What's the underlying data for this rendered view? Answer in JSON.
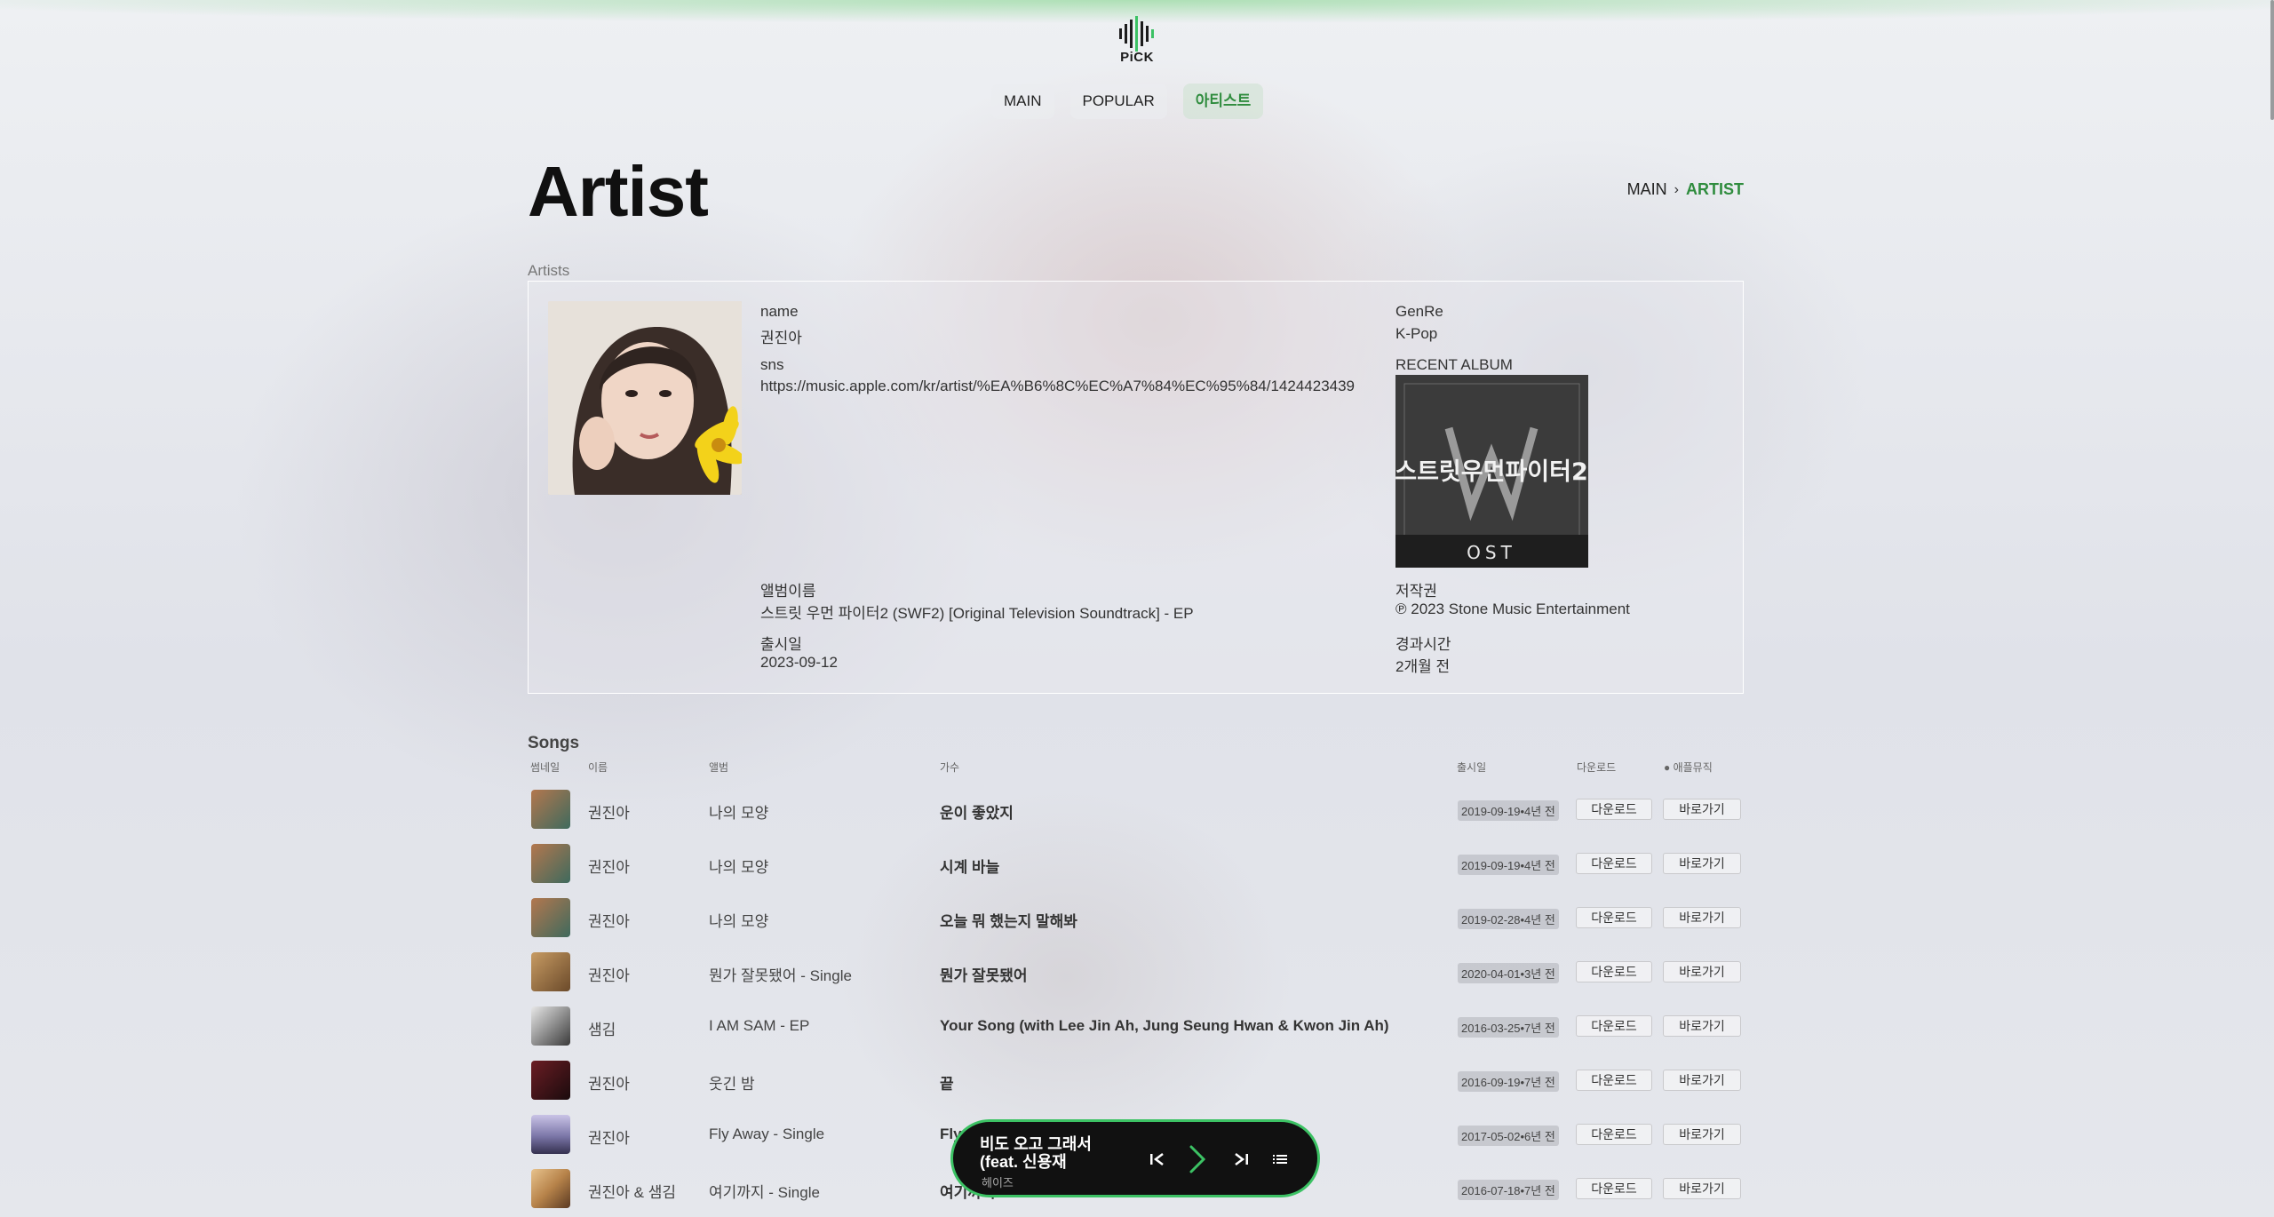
{
  "logo": {
    "text": "PiCK"
  },
  "nav": [
    {
      "label": "MAIN",
      "active": false
    },
    {
      "label": "POPULAR",
      "active": false
    },
    {
      "label": "아티스트",
      "active": true
    }
  ],
  "page": {
    "title": "Artist"
  },
  "breadcrumb": {
    "home": "MAIN",
    "current": "ARTIST"
  },
  "artist_section": {
    "label": "Artists",
    "name_label": "name",
    "name": "권진아",
    "genre_label": "GenRe",
    "genre": "K-Pop",
    "sns_label": "sns",
    "sns": "https://music.apple.com/kr/artist/%EA%B6%8C%EC%A7%84%EC%95%84/1424423439",
    "recent_album_label": "RECENT ALBUM",
    "album_art_text": "스트릿우먼파이터2",
    "album_art_sub": "OST",
    "album_name_label": "앨범이름",
    "album_name": "스트릿 우먼 파이터2 (SWF2) [Original Television Soundtrack] - EP",
    "copyright_label": "저작권",
    "copyright": "℗ 2023 Stone Music Entertainment",
    "release_label": "출시일",
    "release_date": "2023-09-12",
    "elapsed_label": "경과시간",
    "elapsed": "2개월 전"
  },
  "songs": {
    "title": "Songs",
    "headers": {
      "thumb": "썸네일",
      "name": "이름",
      "album": "앨범",
      "title": "가수",
      "date": "출시일",
      "download": "다운로드",
      "apple": "● 애플뮤직"
    },
    "rows": [
      {
        "name": "권진아",
        "album": "나의 모양",
        "title": "운이 좋았지",
        "date": "2019-09-19•4년 전",
        "download": "다운로드",
        "go": "바로가기",
        "thumb_color": "#b3774e"
      },
      {
        "name": "권진아",
        "album": "나의 모양",
        "title": "시계 바늘",
        "date": "2019-09-19•4년 전",
        "download": "다운로드",
        "go": "바로가기",
        "thumb_color": "#b3774e"
      },
      {
        "name": "권진아",
        "album": "나의 모양",
        "title": "오늘 뭐 했는지 말해봐",
        "date": "2019-02-28•4년 전",
        "download": "다운로드",
        "go": "바로가기",
        "thumb_color": "#b3774e"
      },
      {
        "name": "권진아",
        "album": "뭔가 잘못됐어 - Single",
        "title": "뭔가 잘못됐어",
        "date": "2020-04-01•3년 전",
        "download": "다운로드",
        "go": "바로가기",
        "thumb_color": "#c79b63"
      },
      {
        "name": "샘김",
        "album": "I AM SAM - EP",
        "title": "Your Song (with Lee Jin Ah, Jung Seung Hwan & Kwon Jin Ah)",
        "date": "2016-03-25•7년 전",
        "download": "다운로드",
        "go": "바로가기",
        "thumb_color": "#e8e8e8"
      },
      {
        "name": "권진아",
        "album": "웃긴 밤",
        "title": "끝",
        "date": "2016-09-19•7년 전",
        "download": "다운로드",
        "go": "바로가기",
        "thumb_color": "#6b1d24"
      },
      {
        "name": "권진아",
        "album": "Fly Away - Single",
        "title": "Fly Away",
        "date": "2017-05-02•6년 전",
        "download": "다운로드",
        "go": "바로가기",
        "thumb_color": "#7b76a8"
      },
      {
        "name": "권진아 & 샘김",
        "album": "여기까지 - Single",
        "title": "여기까지",
        "date": "2016-07-18•7년 전",
        "download": "다운로드",
        "go": "바로가기",
        "thumb_color": "#b7834a"
      }
    ]
  },
  "player": {
    "title": "비도 오고 그래서 (feat. 신용재",
    "artist": "헤이즈",
    "icons": [
      "prev-icon",
      "play-icon",
      "next-icon",
      "playlist-icon"
    ]
  },
  "colors": {
    "accent": "#2f8c3e",
    "player_border": "#3cc264",
    "player_bg": "#111111"
  }
}
